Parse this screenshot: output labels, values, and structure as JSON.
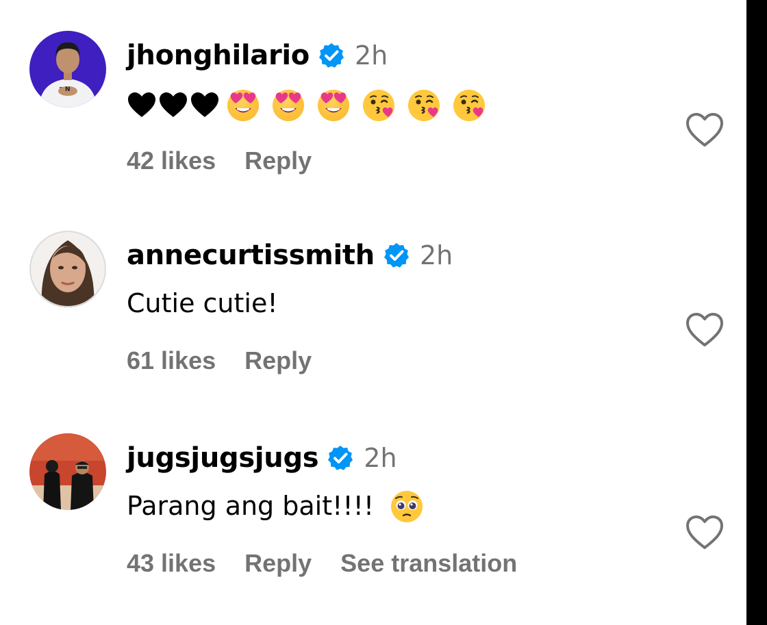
{
  "comments": [
    {
      "username": "jhonghilario",
      "time": "2h",
      "text": "",
      "emojis": [
        "black-heart",
        "black-heart",
        "black-heart",
        "heart-eyes-face",
        "heart-eyes-face",
        "heart-eyes-face",
        "kissing-face",
        "kissing-face",
        "kissing-face"
      ],
      "likes": "42 likes",
      "reply": "Reply"
    },
    {
      "username": "annecurtissmith",
      "time": "2h",
      "text": "Cutie cutie!",
      "likes": "61 likes",
      "reply": "Reply"
    },
    {
      "username": "jugsjugsjugs",
      "time": "2h",
      "text": "Parang ang bait!!!!",
      "emojis": [
        "pleading-face"
      ],
      "likes": "43 likes",
      "reply": "Reply",
      "see_translation": "See translation"
    }
  ],
  "colors": {
    "verified": "#0095f6",
    "meta_text": "#737373",
    "text": "#000000",
    "background": "#ffffff"
  }
}
